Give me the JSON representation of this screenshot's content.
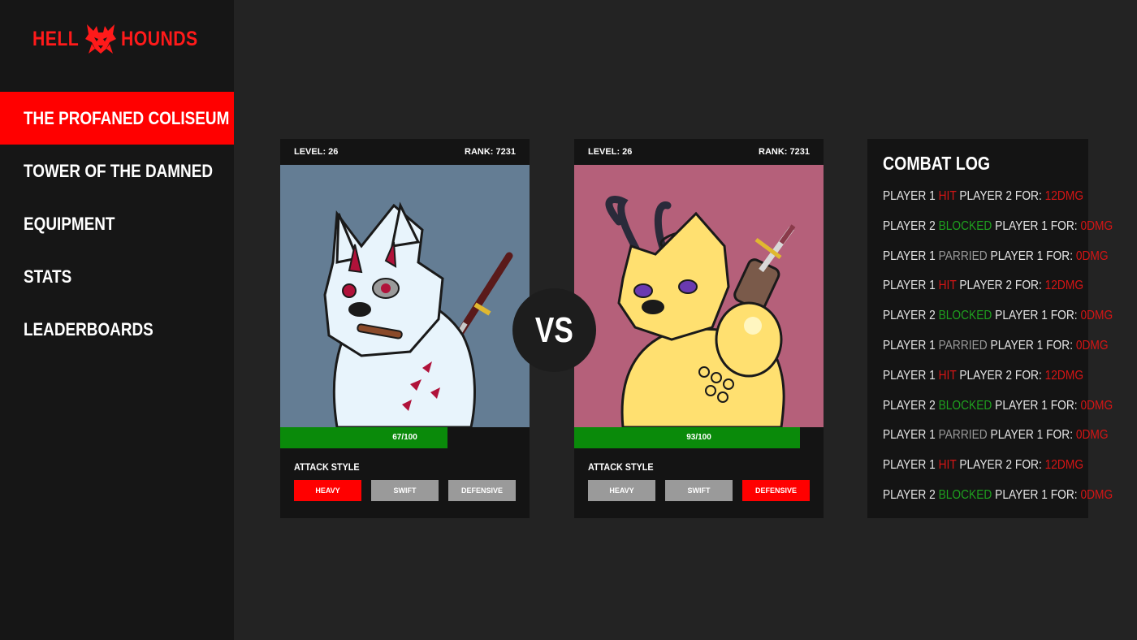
{
  "brand": {
    "left": "HELL",
    "right": "HOUNDS",
    "logo_icon": "hound-skull-icon",
    "color": "#ff1a1a"
  },
  "nav": {
    "items": [
      {
        "label": "THE PROFANED COLISEUM",
        "active": true
      },
      {
        "label": "TOWER OF THE DAMNED",
        "active": false
      },
      {
        "label": "EQUIPMENT",
        "active": false
      },
      {
        "label": "STATS",
        "active": false
      },
      {
        "label": "LEADERBOARDS",
        "active": false
      }
    ]
  },
  "fighters": [
    {
      "level": "LEVEL: 26",
      "rank": "RANK: 7231",
      "hp_text": "67/100",
      "hp_fraction": 0.67,
      "art_bg": "#647d94",
      "attack_style_label": "ATTACK STYLE",
      "buttons": [
        {
          "label": "HEAVY",
          "selected": true
        },
        {
          "label": "SWIFT",
          "selected": false
        },
        {
          "label": "DEFENSIVE",
          "selected": false
        }
      ]
    },
    {
      "level": "LEVEL: 26",
      "rank": "RANK: 7231",
      "hp_text": "93/100",
      "hp_fraction": 0.905,
      "art_bg": "#b5607a",
      "attack_style_label": "ATTACK STYLE",
      "buttons": [
        {
          "label": "HEAVY",
          "selected": false
        },
        {
          "label": "SWIFT",
          "selected": false
        },
        {
          "label": "DEFENSIVE",
          "selected": true
        }
      ]
    }
  ],
  "vs_label": "VS",
  "combat_log": {
    "title": "COMBAT LOG",
    "entries": [
      {
        "actor": "PLAYER 1",
        "action": "HIT",
        "target": "PLAYER 2",
        "for": "FOR:",
        "dmg": "12DMG"
      },
      {
        "actor": "PLAYER 2",
        "action": "BLOCKED",
        "target": "PLAYER 1",
        "for": "FOR:",
        "dmg": "0DMG"
      },
      {
        "actor": "PLAYER 1",
        "action": "PARRIED",
        "target": "PLAYER 1",
        "for": "FOR:",
        "dmg": "0DMG"
      },
      {
        "actor": "PLAYER 1",
        "action": "HIT",
        "target": "PLAYER 2",
        "for": "FOR:",
        "dmg": "12DMG"
      },
      {
        "actor": "PLAYER 2",
        "action": "BLOCKED",
        "target": "PLAYER 1",
        "for": "FOR:",
        "dmg": "0DMG"
      },
      {
        "actor": "PLAYER 1",
        "action": "PARRIED",
        "target": "PLAYER 1",
        "for": "FOR:",
        "dmg": "0DMG"
      },
      {
        "actor": "PLAYER 1",
        "action": "HIT",
        "target": "PLAYER 2",
        "for": "FOR:",
        "dmg": "12DMG"
      },
      {
        "actor": "PLAYER 2",
        "action": "BLOCKED",
        "target": "PLAYER 1",
        "for": "FOR:",
        "dmg": "0DMG"
      },
      {
        "actor": "PLAYER 1",
        "action": "PARRIED",
        "target": "PLAYER 1",
        "for": "FOR:",
        "dmg": "0DMG"
      },
      {
        "actor": "PLAYER 1",
        "action": "HIT",
        "target": "PLAYER 2",
        "for": "FOR:",
        "dmg": "12DMG"
      },
      {
        "actor": "PLAYER 2",
        "action": "BLOCKED",
        "target": "PLAYER 1",
        "for": "FOR:",
        "dmg": "0DMG"
      }
    ]
  },
  "colors": {
    "accent": "#ff0000",
    "hp": "#0a8a0a",
    "hit": "#d51515",
    "blocked": "#1fa01f",
    "parried": "#9a9a9a"
  }
}
